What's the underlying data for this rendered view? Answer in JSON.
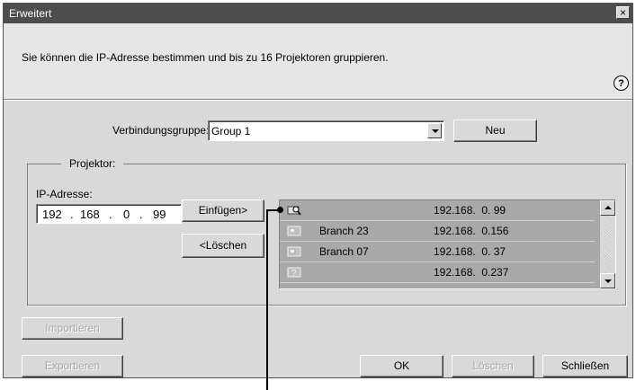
{
  "window": {
    "title": "Erweitert",
    "close_label": "×"
  },
  "intro": {
    "text": "Sie können die IP-Adresse bestimmen und bis zu 16 Projektoren gruppieren.",
    "help_label": "?"
  },
  "connection_group": {
    "label": "Verbindungsgruppe:",
    "value": "Group 1",
    "new_button": "Neu"
  },
  "projector": {
    "group_title": "Projektor:",
    "ip_label": "IP-Adresse:",
    "ip_value": {
      "octet1": "192",
      "octet2": "168",
      "octet3": "0",
      "octet4": "99",
      "dot": "."
    },
    "insert_button": "Einfügen>",
    "delete_button": "<Löschen",
    "list": [
      {
        "icon": "search-projector-icon",
        "name": "",
        "ip": "192.168.  0. 99"
      },
      {
        "icon": "projector-icon",
        "name": "Branch 23",
        "ip": "192.168.  0.156"
      },
      {
        "icon": "projector-icon",
        "name": "Branch 07",
        "ip": "192.168.  0. 37"
      },
      {
        "icon": "unknown-projector-icon",
        "name": "",
        "ip": "192.168.  0.237"
      }
    ]
  },
  "buttons": {
    "import": "Importieren",
    "export": "Exportieren",
    "ok": "OK",
    "delete": "Löschen",
    "close": "Schließen"
  }
}
